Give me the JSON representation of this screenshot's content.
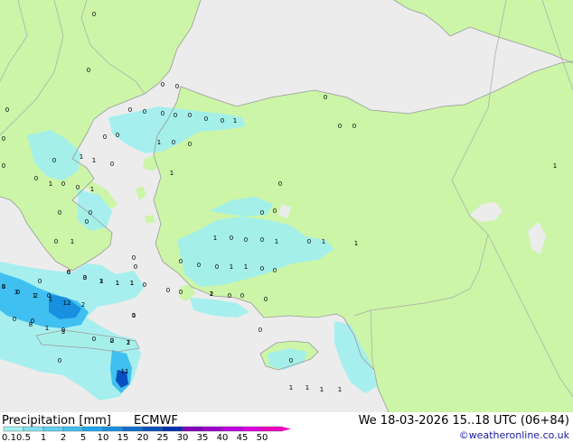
{
  "colors": {
    "land": "#ccf5a8",
    "sea": "#ececec",
    "coast": "#9a9a9a",
    "border": "#a8a8a8"
  },
  "header": {
    "title": "Precipitation [mm]",
    "model": "ECMWF",
    "valid_time": "We 18-03-2026 15..18 UTC (06+84)",
    "credit": "©weatheronline.co.uk"
  },
  "legend": {
    "labels": [
      "0.1",
      "0.5",
      "1",
      "2",
      "5",
      "10",
      "15",
      "20",
      "25",
      "30",
      "35",
      "40",
      "45",
      "50"
    ],
    "colors": [
      "#a0f0f0",
      "#80e0f0",
      "#60d0f0",
      "#40c0f0",
      "#20a8f0",
      "#1890e0",
      "#1070d0",
      "#0850c0",
      "#0030b0",
      "#8000c0",
      "#a000d0",
      "#c000e0",
      "#e000e0",
      "#f000c0"
    ]
  },
  "precip_labels": [
    {
      "v": "0"
    },
    {
      "v": "0"
    },
    {
      "v": "0"
    },
    {
      "v": "0"
    },
    {
      "v": "0"
    },
    {
      "v": "0"
    },
    {
      "v": "0"
    },
    {
      "v": "0"
    },
    {
      "v": "0"
    },
    {
      "v": "0"
    },
    {
      "v": "0"
    },
    {
      "v": "1"
    },
    {
      "v": "1"
    },
    {
      "v": "0"
    },
    {
      "v": "0"
    },
    {
      "v": "0"
    },
    {
      "v": "0"
    },
    {
      "v": "1"
    },
    {
      "v": "1"
    },
    {
      "v": "0"
    },
    {
      "v": "0"
    },
    {
      "v": "0"
    },
    {
      "v": "1"
    },
    {
      "v": "0"
    },
    {
      "v": "0"
    },
    {
      "v": "1"
    },
    {
      "v": "1"
    },
    {
      "v": "1"
    },
    {
      "v": "0"
    },
    {
      "v": "0"
    },
    {
      "v": "0"
    },
    {
      "v": "1"
    },
    {
      "v": "0"
    },
    {
      "v": "0"
    },
    {
      "v": "0"
    },
    {
      "v": "0"
    },
    {
      "v": "1"
    },
    {
      "v": "1"
    },
    {
      "v": "0"
    },
    {
      "v": "0"
    },
    {
      "v": "0"
    },
    {
      "v": "1"
    },
    {
      "v": "1"
    },
    {
      "v": "0"
    },
    {
      "v": "0"
    },
    {
      "v": "0"
    },
    {
      "v": "1"
    },
    {
      "v": "1"
    },
    {
      "v": "1"
    },
    {
      "v": "0"
    },
    {
      "v": "0"
    },
    {
      "v": "0"
    },
    {
      "v": "0"
    },
    {
      "v": "0"
    },
    {
      "v": "1"
    },
    {
      "v": "1"
    },
    {
      "v": "0"
    },
    {
      "v": "0"
    },
    {
      "v": "0"
    },
    {
      "v": "1"
    },
    {
      "v": "0"
    },
    {
      "v": "0"
    },
    {
      "v": "0"
    },
    {
      "v": "6"
    },
    {
      "v": "3"
    },
    {
      "v": "3"
    },
    {
      "v": "1"
    },
    {
      "v": "1"
    },
    {
      "v": "0"
    },
    {
      "v": "1"
    },
    {
      "v": "1"
    },
    {
      "v": "2"
    },
    {
      "v": "3"
    },
    {
      "v": "12"
    },
    {
      "v": "2"
    },
    {
      "v": "0"
    },
    {
      "v": "8"
    },
    {
      "v": "1"
    },
    {
      "v": "3"
    },
    {
      "v": "0"
    },
    {
      "v": "2"
    },
    {
      "v": "2"
    },
    {
      "v": "0"
    },
    {
      "v": "11"
    },
    {
      "v": "0"
    },
    {
      "v": "1"
    },
    {
      "v": "1"
    },
    {
      "v": "1"
    },
    {
      "v": "1"
    },
    {
      "v": "1"
    },
    {
      "v": "0"
    },
    {
      "v": "0"
    },
    {
      "v": "2"
    },
    {
      "v": "0"
    },
    {
      "v": "0"
    },
    {
      "v": "0"
    },
    {
      "v": "0"
    },
    {
      "v": "0"
    },
    {
      "v": "1"
    },
    {
      "v": "0"
    },
    {
      "v": "0"
    },
    {
      "v": "0"
    },
    {
      "v": "0"
    },
    {
      "v": "1"
    },
    {
      "v": "0"
    },
    {
      "v": "0"
    },
    {
      "v": "0"
    },
    {
      "v": "0"
    },
    {
      "v": "0"
    }
  ]
}
